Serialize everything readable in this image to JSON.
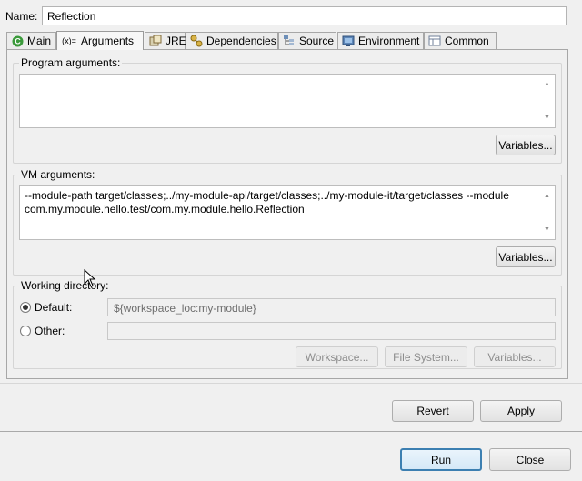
{
  "name": {
    "label": "Name:",
    "value": "Reflection"
  },
  "tabs": [
    {
      "label": "Main",
      "icon": "main-class-icon"
    },
    {
      "label": "Arguments",
      "icon": "arguments-icon",
      "active": true
    },
    {
      "label": "JRE",
      "icon": "jre-icon"
    },
    {
      "label": "Dependencies",
      "icon": "dependencies-icon"
    },
    {
      "label": "Source",
      "icon": "source-icon"
    },
    {
      "label": "Environment",
      "icon": "environment-icon"
    },
    {
      "label": "Common",
      "icon": "common-icon"
    }
  ],
  "arguments_icon_text": "(x)=",
  "program_args": {
    "label": "Program arguments:",
    "value": "",
    "variables": "Variables..."
  },
  "vm_args": {
    "label": "VM arguments:",
    "value": "--module-path target/classes;../my-module-api/target/classes;../my-module-it/target/classes --module com.my.module.hello.test/com.my.module.hello.Reflection",
    "variables": "Variables..."
  },
  "working_dir": {
    "label": "Working directory:",
    "default_label": "Default:",
    "default_value": "${workspace_loc:my-module}",
    "other_label": "Other:",
    "other_value": "",
    "selected": "default",
    "workspace_btn": "Workspace...",
    "filesystem_btn": "File System...",
    "variables_btn": "Variables..."
  },
  "footer": {
    "revert": "Revert",
    "apply": "Apply",
    "run": "Run",
    "close": "Close"
  },
  "colors": {
    "default_button_border": "#3c7fb1",
    "panel_bg": "#f0f0f0"
  }
}
